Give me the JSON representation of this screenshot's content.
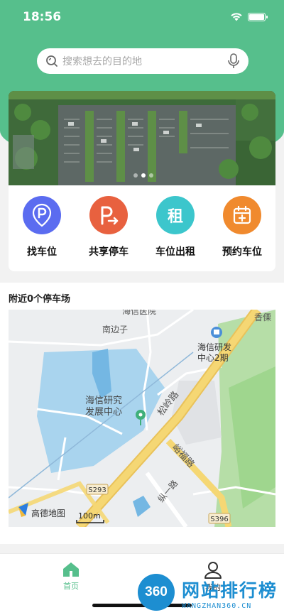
{
  "status": {
    "time": "18:56"
  },
  "search": {
    "placeholder": "搜索想去的目的地"
  },
  "menu": [
    {
      "label": "找车位",
      "icon": "parking-pin-icon",
      "color": "#5b6cf0"
    },
    {
      "label": "共享停车",
      "icon": "share-parking-icon",
      "color": "#e8613f"
    },
    {
      "label": "车位出租",
      "icon": "rent-icon",
      "color": "#3cc6cc",
      "glyph": "租"
    },
    {
      "label": "预约车位",
      "icon": "calendar-plus-icon",
      "color": "#f08a2e"
    }
  ],
  "nearby": {
    "title": "附近0个停车场"
  },
  "map": {
    "labels": {
      "haixin_hospital": "海信医院",
      "nanbianzi": "南边子",
      "xiangbao": "香傈",
      "haixin_rd2": "海信研发",
      "haixin_rd2_b": "中心2期",
      "haixin_research": "海信研究",
      "haixin_research_b": "发展中心",
      "songling_road": "松岭路",
      "yufu_road": "峪福路",
      "zongyi_road": "纵一路",
      "s293": "S293",
      "s396": "S396",
      "amap": "高德地图",
      "scale": "100m"
    }
  },
  "tabs": [
    {
      "label": "首页",
      "active": true,
      "color": "#56bf8c"
    },
    {
      "label": "我的",
      "active": false,
      "color": "#333333"
    }
  ],
  "watermark": {
    "circle": "360",
    "title": "网站排行榜",
    "sub": "WANGZHAN360.CN"
  }
}
